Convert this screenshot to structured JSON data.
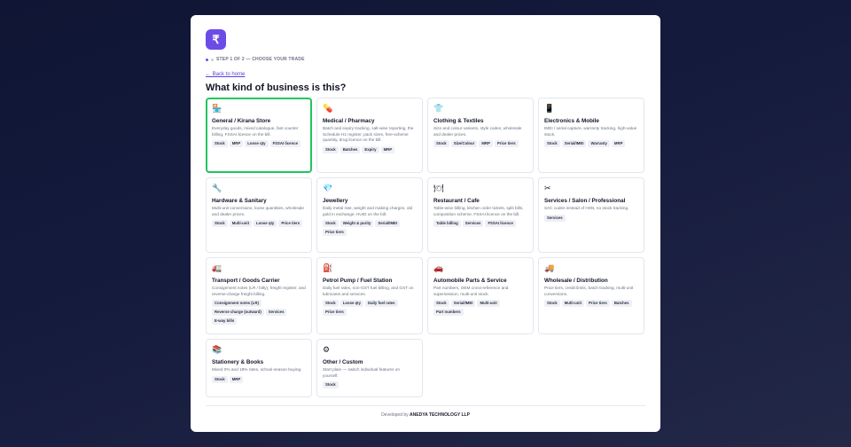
{
  "logo": {
    "glyph": "₹"
  },
  "step": {
    "text": "STEP 1 OF 2 — CHOOSE YOUR TRADE"
  },
  "back_link": "← Back to home",
  "heading": "What kind of business is this?",
  "businesses": [
    {
      "icon": "🏪",
      "name": "General / Kirana Store",
      "desc": "Everyday goods, mixed catalogue, fast counter billing, FSSAI licence on the bill.",
      "tags": [
        "Stock",
        "MRP",
        "Loose qty",
        "FSSAI licence"
      ],
      "selected": true
    },
    {
      "icon": "💊",
      "name": "Medical / Pharmacy",
      "desc": "Batch and expiry tracking, salt-wise reporting, the Schedule H1 register, pack sizes, free-scheme quantity, drug licence on the bill.",
      "tags": [
        "Stock",
        "Batches",
        "Expiry",
        "MRP"
      ]
    },
    {
      "icon": "👕",
      "name": "Clothing & Textiles",
      "desc": "Size and colour variants, style codes, wholesale and dealer prices.",
      "tags": [
        "Stock",
        "Size/Colour",
        "MRP",
        "Price tiers"
      ]
    },
    {
      "icon": "📱",
      "name": "Electronics & Mobile",
      "desc": "IMEI / serial capture, warranty tracking, high-value stock.",
      "tags": [
        "Stock",
        "Serial/IMEI",
        "Warranty",
        "MRP"
      ]
    },
    {
      "icon": "🔧",
      "name": "Hardware & Sanitary",
      "desc": "Multi-unit conversions, loose quantities, wholesale and dealer prices.",
      "tags": [
        "Stock",
        "Multi-unit",
        "Loose qty",
        "Price tiers"
      ]
    },
    {
      "icon": "💎",
      "name": "Jewellery",
      "desc": "Daily metal rate, weight and making charges, old gold in exchange, HUID on the bill.",
      "tags": [
        "Stock",
        "Weight & purity",
        "Serial/IMEI",
        "Price tiers"
      ]
    },
    {
      "icon": "🍽",
      "name": "Restaurant / Cafe",
      "desc": "Table-wise billing, kitchen order tickets, split bills, composition scheme, FSSAI licence on the bill.",
      "tags": [
        "Table billing",
        "Services",
        "FSSAI licence"
      ]
    },
    {
      "icon": "✂",
      "name": "Services / Salon / Professional",
      "desc": "SAC codes instead of HSN, no stock tracking.",
      "tags": [
        "Services"
      ]
    },
    {
      "icon": "🚛",
      "name": "Transport / Goods Carrier",
      "desc": "Consignment notes (LR / bilty), freight register, and reverse-charge freight billing.",
      "tags": [
        "Consignment notes (LR)",
        "Reverse charge (outward)",
        "Services",
        "E-way bills"
      ]
    },
    {
      "icon": "⛽",
      "name": "Petrol Pump / Fuel Station",
      "desc": "Daily fuel rates, non-GST fuel billing, and GST on lubricants and services.",
      "tags": [
        "Stock",
        "Loose qty",
        "Daily fuel rates",
        "Price tiers"
      ]
    },
    {
      "icon": "🚗",
      "name": "Automobile Parts & Service",
      "desc": "Part numbers, OEM cross-reference and supersession, multi-unit stock.",
      "tags": [
        "Stock",
        "Serial/IMEI",
        "Multi-unit",
        "Part numbers"
      ]
    },
    {
      "icon": "🚚",
      "name": "Wholesale / Distribution",
      "desc": "Price tiers, credit limits, batch tracking, multi-unit conversions.",
      "tags": [
        "Stock",
        "Multi-unit",
        "Price tiers",
        "Batches"
      ]
    },
    {
      "icon": "📚",
      "name": "Stationery & Books",
      "desc": "Mixed 0% and 18% rates, school-season buying.",
      "tags": [
        "Stock",
        "MRP"
      ]
    },
    {
      "icon": "⚙",
      "name": "Other / Custom",
      "desc": "Start plain — switch individual features on yourself.",
      "tags": [
        "Stock"
      ]
    }
  ],
  "footer": {
    "prefix": "Developed by",
    "company": "ANEDYA TECHNOLOGY LLP"
  }
}
